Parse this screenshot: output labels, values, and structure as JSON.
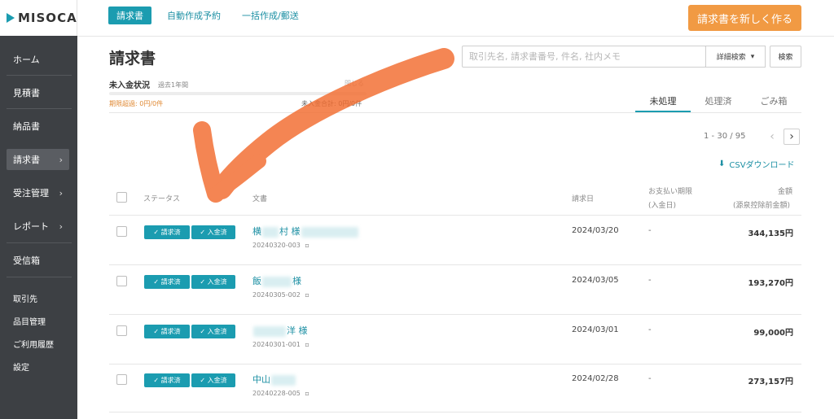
{
  "brand": {
    "logo_text": "MISOCA"
  },
  "sidebar": {
    "items": [
      {
        "label": "ホーム"
      },
      {
        "label": "見積書"
      },
      {
        "label": "納品書"
      },
      {
        "label": "請求書",
        "chevron": "›"
      },
      {
        "label": "受注管理",
        "chevron": "›"
      },
      {
        "label": "レポート",
        "chevron": "›"
      },
      {
        "label": "受信箱"
      }
    ],
    "sub_items": [
      {
        "label": "取引先"
      },
      {
        "label": "品目管理"
      },
      {
        "label": "ご利用履歴"
      },
      {
        "label": "設定"
      }
    ]
  },
  "top_tabs": [
    {
      "label": "請求書"
    },
    {
      "label": "自動作成予約"
    },
    {
      "label": "一括作成/郵送"
    }
  ],
  "create_button": "請求書を新しく作る",
  "page_title": "請求書",
  "search": {
    "placeholder": "取引先名, 請求書番号, 件名, 社内メモ",
    "advanced_label": "詳細検索",
    "advanced_caret": "▾",
    "button_label": "検索"
  },
  "summary": {
    "title": "未入金状況",
    "period": "過去1年間",
    "close_label": "閉じる",
    "overdue": "期限超過: 0円/0件",
    "unpaid_total": "未入金合計: 0円/0件"
  },
  "state_tabs": [
    {
      "label": "未処理"
    },
    {
      "label": "処理済"
    },
    {
      "label": "ごみ箱"
    }
  ],
  "pager": {
    "range": "1 - 30 / 95",
    "prev": "‹",
    "next": "›"
  },
  "csv": {
    "icon": "download-icon",
    "glyph": "⬇",
    "label": "CSVダウンロード"
  },
  "table": {
    "headers": {
      "status": "ステータス",
      "document": "文書",
      "invoice_date": "請求日",
      "due_date": "お支払い期限",
      "due_date_sub": "(入金日)",
      "amount": "金額",
      "amount_sub": "(源泉控除前金額)"
    },
    "badge_glyph": "✓",
    "rows": [
      {
        "badges": [
          "請求済",
          "入金済"
        ],
        "client_prefix": "横",
        "client_suffix": "村 様",
        "doc_no": "20240320-003",
        "doc_icon": "comment-icon",
        "doc_glyph": "▫",
        "date": "2024/03/20",
        "due": "-",
        "amount": "344,135円"
      },
      {
        "badges": [
          "請求済",
          "入金済"
        ],
        "client_prefix": "飯",
        "client_suffix": "様",
        "doc_no": "20240305-002",
        "doc_icon": "comment-icon",
        "doc_glyph": "▫",
        "date": "2024/03/05",
        "due": "-",
        "amount": "193,270円"
      },
      {
        "badges": [
          "請求済",
          "入金済"
        ],
        "client_prefix": "",
        "client_suffix": "洋 様",
        "doc_no": "20240301-001",
        "doc_icon": "comment-icon",
        "doc_glyph": "▫",
        "date": "2024/03/01",
        "due": "-",
        "amount": "99,000円"
      },
      {
        "badges": [
          "請求済",
          "入金済"
        ],
        "client_prefix": "中山",
        "client_suffix": "",
        "doc_no": "20240228-005",
        "doc_icon": "comment-icon",
        "doc_glyph": "▫",
        "date": "2024/02/28",
        "due": "-",
        "amount": "273,157円"
      }
    ]
  },
  "colors": {
    "accent": "#1b9cb0",
    "sidebar_bg": "#3d4044",
    "create_button": "#f19a43",
    "annotation_arrow": "#f26b2e"
  },
  "annotation": {
    "type": "hand-drawn-arrow",
    "points_to": "status-column-header"
  }
}
